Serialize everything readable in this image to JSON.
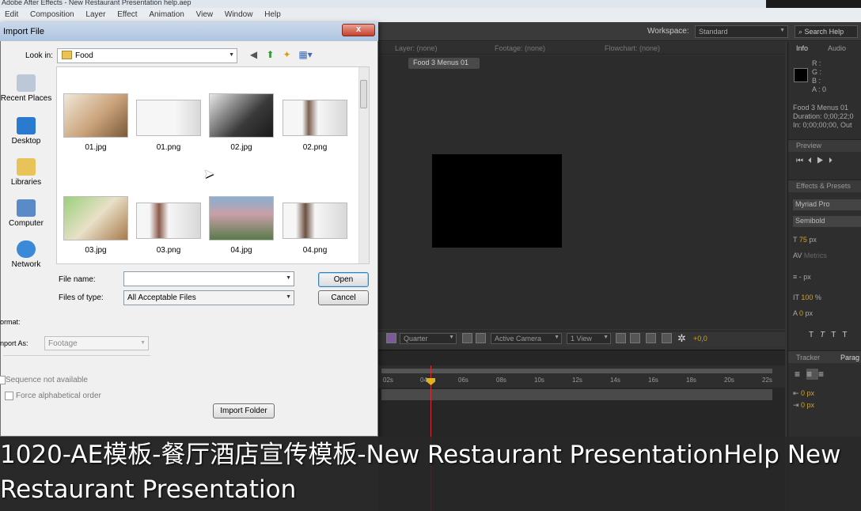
{
  "app": {
    "title": "Adobe After Effects - New Restaurant Presentation help.aep",
    "menu": [
      "Edit",
      "Composition",
      "Layer",
      "Effect",
      "Animation",
      "View",
      "Window",
      "Help"
    ],
    "workspace_label": "Workspace:",
    "workspace_value": "Standard",
    "search_help": "Search Help"
  },
  "panels": {
    "layer_tab": "Layer: (none)",
    "footage_tab": "Footage: (none)",
    "flowchart_tab": "Flowchart: (none)",
    "comp_tab": "Food 3 Menus 01",
    "viewer_bar": {
      "resolution": "Quarter",
      "camera": "Active Camera",
      "views": "1 View",
      "exposure": "+0,0"
    },
    "timeline_ticks": [
      "02s",
      "04s",
      "06s",
      "08s",
      "10s",
      "12s",
      "14s",
      "16s",
      "18s",
      "20s",
      "22s"
    ],
    "info": {
      "tab": "Info",
      "audio_tab": "Audio",
      "channels": [
        "R :",
        "G :",
        "B :",
        "A : 0"
      ],
      "comp_name": "Food 3 Menus 01",
      "duration": "Duration: 0;00;22;0",
      "in_out": "In: 0;00;00;00, Out"
    },
    "preview_tab": "Preview",
    "effects_tab": "Effects & Presets",
    "character": {
      "font": "Myriad Pro",
      "style": "Semibold",
      "size": "75",
      "size_unit": "px",
      "kerning": "Metrics",
      "leading_value": "-",
      "leading_unit": "px",
      "vscale": "100",
      "vscale_unit": "%",
      "baseline": "0",
      "baseline_unit": "px"
    },
    "tracker_tab": "Tracker",
    "paragraph_tab": "Parag",
    "para_indent_1": "0 px",
    "para_indent_2": "0 px"
  },
  "dialog": {
    "title": "Import File",
    "close": "x",
    "look_in_label": "Look in:",
    "look_in_value": "Food",
    "places": [
      "Recent Places",
      "Desktop",
      "Libraries",
      "Computer",
      "Network"
    ],
    "files": [
      "01.jpg",
      "01.png",
      "02.jpg",
      "02.png",
      "03.jpg",
      "03.png",
      "04.jpg",
      "04.png"
    ],
    "file_name_label": "File name:",
    "file_name_value": "",
    "files_of_type_label": "Files of type:",
    "files_of_type_value": "All Acceptable Files",
    "open_button": "Open",
    "cancel_button": "Cancel",
    "format_label": "ormat:",
    "import_as_label": "nport As:",
    "import_as_value": "Footage",
    "sequence_label": "Sequence not available",
    "force_alpha_label": "Force alphabetical order",
    "import_folder_button": "Import Folder"
  },
  "subtitle": {
    "line1": "1020-AE模板-餐厅酒店宣传模板-New Restaurant PresentationHelp New",
    "line2": "Restaurant Presentation"
  }
}
